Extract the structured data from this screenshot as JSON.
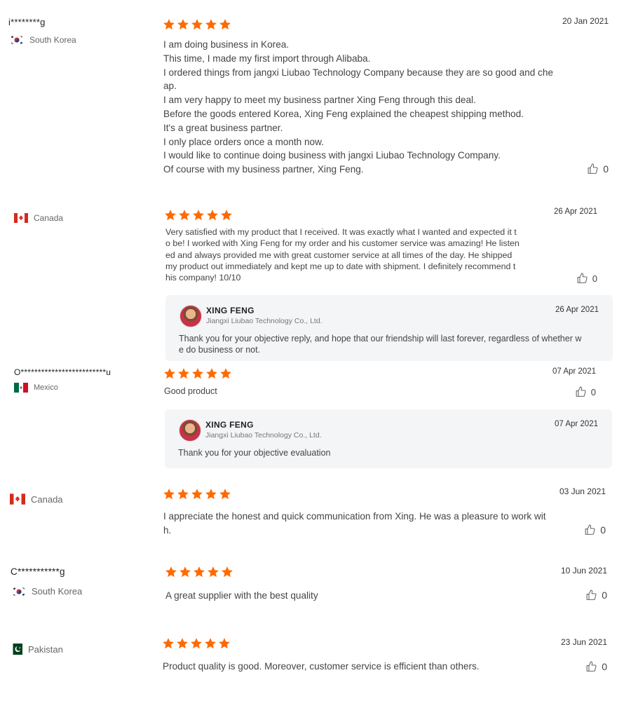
{
  "colors": {
    "star": "#ff6a00",
    "reply_bg": "#f4f5f7"
  },
  "icons": {
    "rating": "star-icon",
    "like": "thumbs-up-icon"
  },
  "reviews": [
    {
      "author": "i********g",
      "country": "South Korea",
      "flag": "south-korea-flag-icon",
      "rating": 5,
      "date": "20 Jan 2021",
      "text": "I am doing business in Korea.\nThis time, I made my first import through Alibaba.\nI ordered things from jangxi Liubao Technology Company because they are so good and che\nap.\nI am very happy to meet my business partner Xing Feng through this deal.\nBefore the goods entered Korea, Xing Feng explained the cheapest shipping method.\nIt's a great business partner.\nI only place orders once a month now.\nI would like to continue doing business with jangxi Liubao Technology Company.\nOf course with my business partner, Xing Feng.",
      "likes": "0"
    },
    {
      "author": "",
      "country": "Canada",
      "flag": "canada-flag-icon",
      "rating": 5,
      "date": "26 Apr 2021",
      "text": "Very satisfied with my product that I received. It was exactly what I wanted and expected it t\no be! I worked with Xing Feng for my order and his customer service was amazing! He listen\ned and always provided me with great customer service at all times of the day. He shipped\nmy product out immediately and kept me up to date with shipment. I definitely recommend t\nhis company! 10/10",
      "likes": "0",
      "reply": {
        "name": "XING FENG",
        "company": "Jiangxi Liubao Technology Co., Ltd.",
        "date": "26 Apr 2021",
        "text": "Thank you for your objective reply, and hope that our friendship will last forever, regardless of whether w\ne do business or not."
      }
    },
    {
      "author": "O*************************u",
      "country": "Mexico",
      "flag": "mexico-flag-icon",
      "rating": 5,
      "date": "07 Apr 2021",
      "text": "Good product",
      "likes": "0",
      "reply": {
        "name": "XING FENG",
        "company": "Jiangxi Liubao Technology Co., Ltd.",
        "date": "07 Apr 2021",
        "text": "Thank you for your objective evaluation"
      }
    },
    {
      "author": "",
      "country": "Canada",
      "flag": "canada-flag-icon",
      "rating": 5,
      "date": "03 Jun 2021",
      "text": "I appreciate the honest and quick communication from Xing. He was a pleasure to work wit\nh.",
      "likes": "0"
    },
    {
      "author": "C***********g",
      "country": "South Korea",
      "flag": "south-korea-flag-icon",
      "rating": 5,
      "date": "10 Jun 2021",
      "text": "A great supplier with the best quality",
      "likes": "0"
    },
    {
      "author": "",
      "country": "Pakistan",
      "flag": "pakistan-flag-icon",
      "rating": 5,
      "date": "23 Jun 2021",
      "text": "Product quality is good. Moreover, customer service is efficient than others.",
      "likes": "0"
    }
  ]
}
